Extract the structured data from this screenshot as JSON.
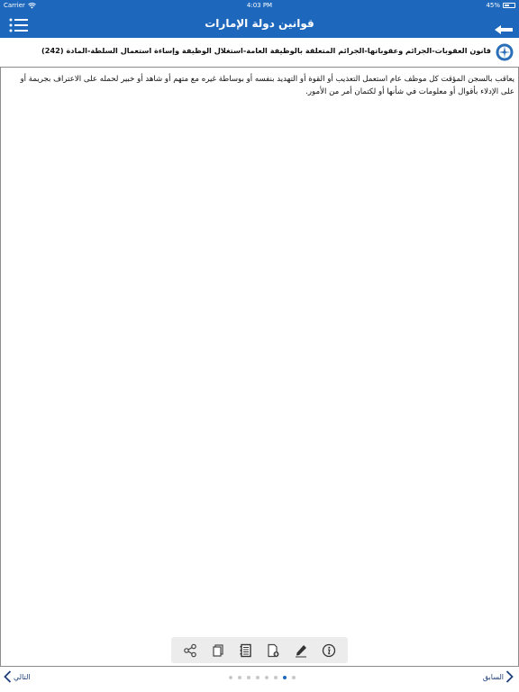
{
  "status_bar": {
    "carrier": "Carrier",
    "time": "4:03 PM",
    "battery": "45%",
    "battery_level": 0.45
  },
  "navbar": {
    "title": "قوانين دولة الإمارات",
    "menu_icon": "menu-icon",
    "back_icon": "back-arrow-icon",
    "color": "#1d68bd"
  },
  "article": {
    "title": "قانون العقوبات-الجرائم وعقوباتها-الجرائم المتعلقة بالوظيفة العامة-استغلال الوظيفة وإساءة استعمال السلطة-المادة (242)",
    "body": "يعاقب بالسجن المؤقت كل موظف عام استعمل التعذيب أو القوة أو التهديد بنفسه أو بوساطة غيره مع متهم أو شاهد أو خبير لحمله على الاعتراف بجريمة أو على الإدلاء بأقوال أو معلومات في شأنها أو لكتمان أمر من الأمور."
  },
  "toolbar": {
    "icons": [
      "share-icon",
      "copy-icon",
      "notes-icon",
      "add-note-icon",
      "edit-icon",
      "info-icon"
    ]
  },
  "footer": {
    "next_label": "التالي",
    "prev_label": "السابق",
    "dot_count": 8,
    "active_dot": 6
  }
}
